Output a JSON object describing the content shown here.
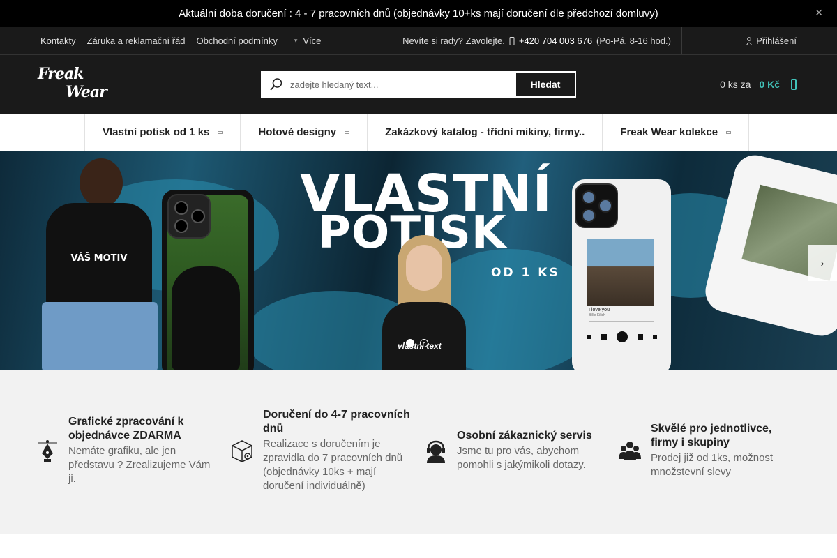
{
  "notice": {
    "text": "Aktuální doba doručení : 4 - 7 pracovních dnů (objednávky 10+ks mají doručení dle předchozí domluvy)",
    "close_icon": "close-icon"
  },
  "topnav": {
    "links": [
      "Kontakty",
      "Záruka a reklamační řád",
      "Obchodní podmínky"
    ],
    "more_label": "Více",
    "help_text": "Nevíte si rady? Zavolejte.",
    "phone_number": "+420 704 003 676",
    "phone_hours": "(Po-Pá, 8-16 hod.)",
    "login_label": "Přihlášení"
  },
  "header": {
    "logo_line1": "Freak",
    "logo_line2": "Wear",
    "search_placeholder": "zadejte hledaný text...",
    "search_button": "Hledat",
    "cart_count": "0 ks za",
    "cart_price": "0 Kč"
  },
  "categories": [
    {
      "label": "Vlastní potisk od 1 ks",
      "has_dropdown": true
    },
    {
      "label": "Hotové designy",
      "has_dropdown": true
    },
    {
      "label": "Zakázkový katalog - třídní mikiny, firmy..",
      "has_dropdown": false
    },
    {
      "label": "Freak Wear kolekce",
      "has_dropdown": true
    }
  ],
  "hero": {
    "title_line1": "VLASTNÍ",
    "title_line2": "POTISK",
    "subtitle": "OD 1 KS",
    "shirt_text": "VÁŠ MOTIV",
    "hoodie_text": "vlastní text",
    "song_title": "I love you",
    "song_artist": "Billie Eilish",
    "slides_total": 2,
    "slide_active": 1
  },
  "features": [
    {
      "icon": "pen-nib-icon",
      "title": "Grafické zpracování k objednávce ZDARMA",
      "desc": "Nemáte grafiku, ale jen představu ? Zrealizujeme Vám ji."
    },
    {
      "icon": "package-icon",
      "title": "Doručení do 4-7 pracovních dnů",
      "desc": "Realizace s doručením je zpravidla do 7 pracovních dnů (objednávky 10ks + mají doručení individuálně)"
    },
    {
      "icon": "support-agent-icon",
      "title": "Osobní zákaznický servis",
      "desc": "Jsme tu pro vás, abychom pomohli s jakýmikoli dotazy."
    },
    {
      "icon": "group-icon",
      "title": "Skvělé pro jednotlivce, firmy i skupiny",
      "desc": "Prodej již od 1ks, možnost množstevní slevy"
    }
  ],
  "colors": {
    "accent": "#41c2b9",
    "dark": "#1a1a1a"
  }
}
